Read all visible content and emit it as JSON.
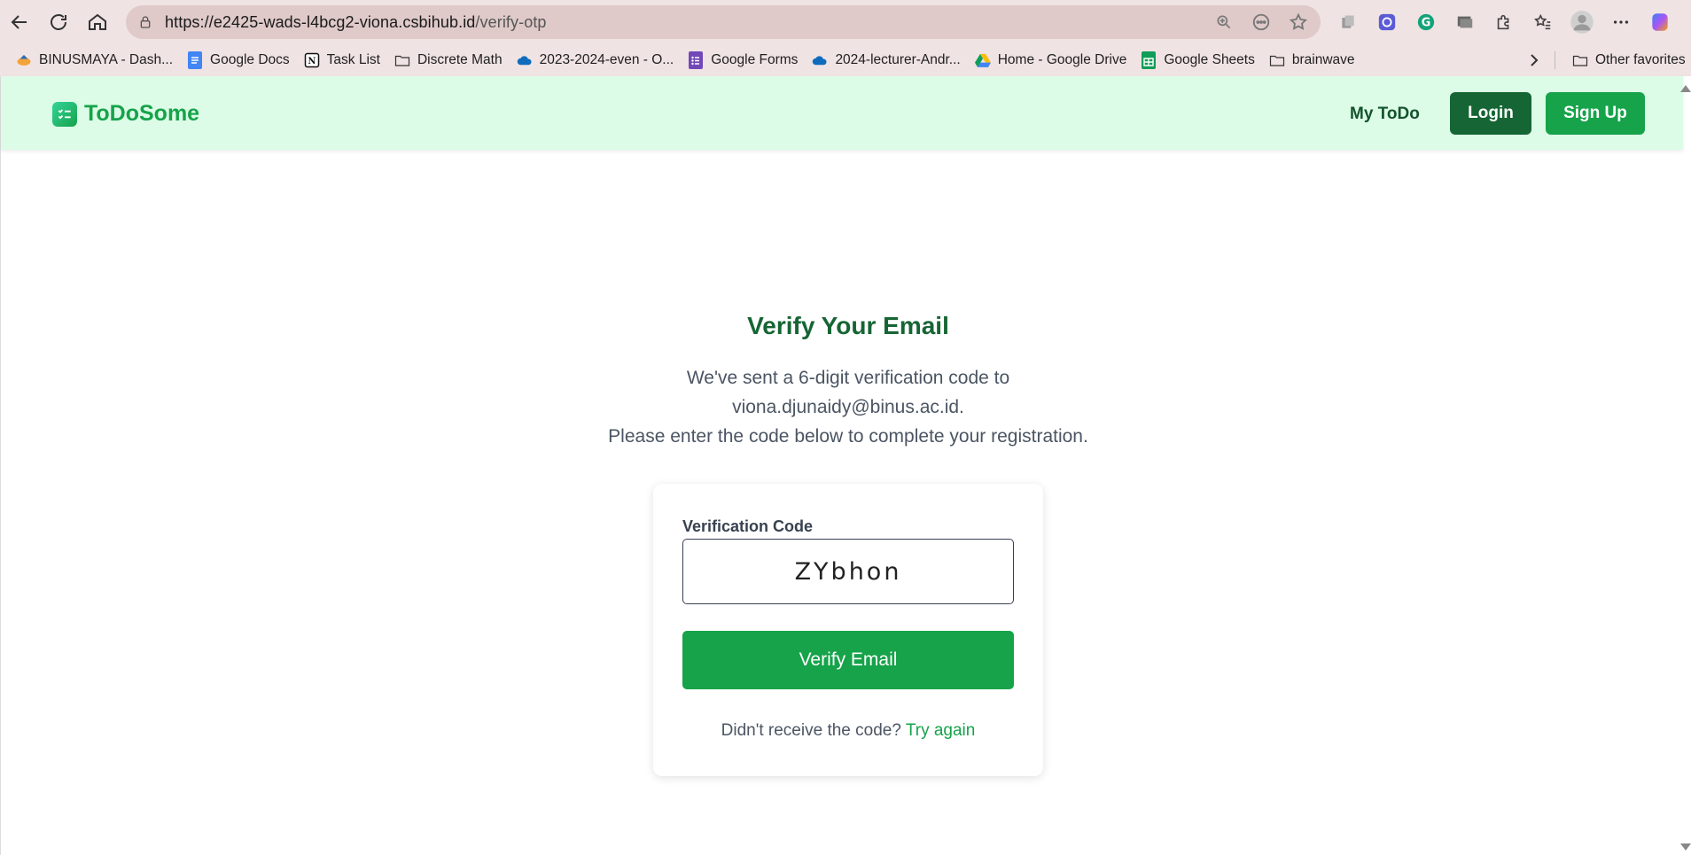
{
  "browser": {
    "url_host": "https://e2425-wads-l4bcg2-viona.csbihub.id",
    "url_path": "/verify-otp",
    "bookmarks": [
      {
        "label": "BINUSMAYA - Dash...",
        "icon": "binusmaya-icon"
      },
      {
        "label": "Google Docs",
        "icon": "google-docs-icon"
      },
      {
        "label": "Task List",
        "icon": "notion-icon"
      },
      {
        "label": "Discrete Math",
        "icon": "folder-icon"
      },
      {
        "label": "2023-2024-even - O...",
        "icon": "onedrive-icon"
      },
      {
        "label": "Google Forms",
        "icon": "google-forms-icon"
      },
      {
        "label": "2024-lecturer-Andr...",
        "icon": "onedrive-icon"
      },
      {
        "label": "Home - Google Drive",
        "icon": "google-drive-icon"
      },
      {
        "label": "Google Sheets",
        "icon": "google-sheets-icon"
      },
      {
        "label": "brainwave",
        "icon": "folder-icon"
      }
    ],
    "other_favorites": "Other favorites"
  },
  "navbar": {
    "brand": "ToDoSome",
    "link_mytodo": "My ToDo",
    "login": "Login",
    "signup": "Sign Up"
  },
  "main": {
    "title": "Verify Your Email",
    "desc_line1": "We've sent a 6-digit verification code to",
    "desc_line2": "viona.djunaidy@binus.ac.id.",
    "desc_line3": "Please enter the code below to complete your registration.",
    "field_label": "Verification Code",
    "code_value": "ZYbhon",
    "verify_button": "Verify Email",
    "resend_text": "Didn't receive the code?",
    "resend_link": "Try again"
  },
  "colors": {
    "brand_green": "#16a34a",
    "dark_green": "#166534",
    "navbar_bg": "#dcfce7",
    "chrome_bg": "#f0e3e3"
  }
}
